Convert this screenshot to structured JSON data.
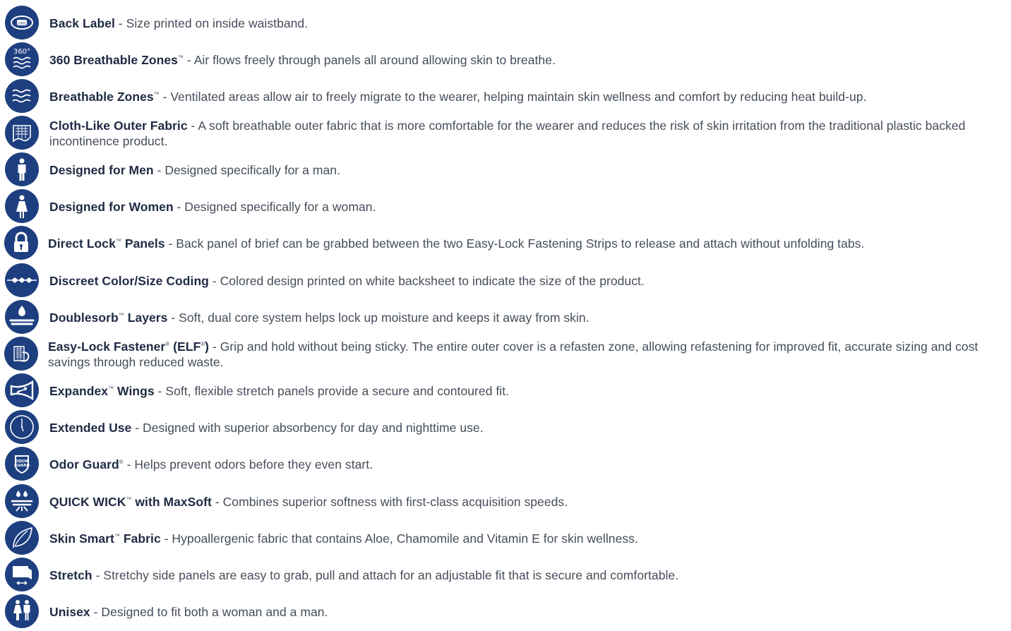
{
  "features": [
    {
      "icon": "back-label-icon",
      "title": "Back Label",
      "mark": "",
      "title_suffix": "",
      "desc": " - Size printed on inside waistband.",
      "badge": "LABEL"
    },
    {
      "icon": "breathable-360-icon",
      "title": "360 Breathable Zones",
      "mark": "™",
      "title_suffix": "",
      "desc": " - Air flows freely through panels all around allowing skin to breathe.",
      "badge": "360°"
    },
    {
      "icon": "breathable-zones-icon",
      "title": "Breathable Zones",
      "mark": "™",
      "title_suffix": "",
      "desc": " - Ventilated areas allow air to freely migrate to the wearer, helping maintain skin wellness and comfort by reducing heat build-up."
    },
    {
      "icon": "cloth-fabric-icon",
      "title": "Cloth-Like Outer Fabric",
      "mark": "",
      "title_suffix": "",
      "desc": " - A soft breathable outer fabric that is more comfortable for the wearer and reduces the risk of skin irritation from the traditional plastic backed incontinence product."
    },
    {
      "icon": "man-icon",
      "title": "Designed for Men",
      "mark": "",
      "title_suffix": "",
      "desc": " - Designed specifically for a man."
    },
    {
      "icon": "woman-icon",
      "title": "Designed for Women",
      "mark": "",
      "title_suffix": "",
      "desc": " - Designed specifically for a woman."
    },
    {
      "icon": "lock-icon",
      "title": "Direct Lock",
      "mark": "™",
      "title_suffix": " Panels",
      "desc": " - Back panel of brief can be grabbed between the two Easy-Lock Fastening Strips to release and attach without unfolding tabs."
    },
    {
      "icon": "color-coding-icon",
      "title": "Discreet Color/Size Coding",
      "mark": "",
      "title_suffix": "",
      "desc": " - Colored design printed on white backsheet to indicate the size of the product."
    },
    {
      "icon": "layers-drop-icon",
      "title": "Doublesorb",
      "mark": "™",
      "title_suffix": " Layers",
      "desc": " - Soft, dual core system helps lock up moisture and keeps it away from skin."
    },
    {
      "icon": "fastener-icon",
      "title": "Easy-Lock Fastener",
      "mark": "®",
      "title_suffix": " (ELF",
      "mark2": "®",
      "title_suffix2": ")",
      "desc": " - Grip and hold without being sticky. The entire outer cover is a refasten zone, allowing refastening for improved fit, accurate sizing and cost savings through reduced waste."
    },
    {
      "icon": "wings-icon",
      "title": "Expandex",
      "mark": "™",
      "title_suffix": " Wings",
      "desc": " - Soft, flexible stretch panels provide a secure and contoured fit."
    },
    {
      "icon": "clock-icon",
      "title": "Extended Use",
      "mark": "",
      "title_suffix": "",
      "desc": " - Designed with superior absorbency for day and nighttime use."
    },
    {
      "icon": "odor-guard-icon",
      "title": "Odor Guard",
      "mark": "®",
      "title_suffix": "",
      "desc": " - Helps prevent odors before they even start.",
      "badge": "ODOR GUARD"
    },
    {
      "icon": "quick-wick-icon",
      "title": "QUICK WICK",
      "mark": "™",
      "title_suffix": " with MaxSoft",
      "desc": " - Combines superior softness with first-class acquisition speeds."
    },
    {
      "icon": "leaf-icon",
      "title": "Skin Smart",
      "mark": "™",
      "title_suffix": " Fabric",
      "desc": " - Hypoallergenic fabric that contains Aloe, Chamomile and Vitamin E for skin wellness."
    },
    {
      "icon": "stretch-icon",
      "title": "Stretch",
      "mark": "",
      "title_suffix": "",
      "desc": " - Stretchy side panels are easy to grab, pull and attach for an adjustable fit that is secure and comfortable."
    },
    {
      "icon": "unisex-icon",
      "title": "Unisex",
      "mark": "",
      "title_suffix": "",
      "desc": " - Designed to fit both a woman and a man."
    }
  ],
  "colors": {
    "icon_bg": "#1e3f7f",
    "title": "#1f2a44",
    "text": "#454d5a"
  }
}
